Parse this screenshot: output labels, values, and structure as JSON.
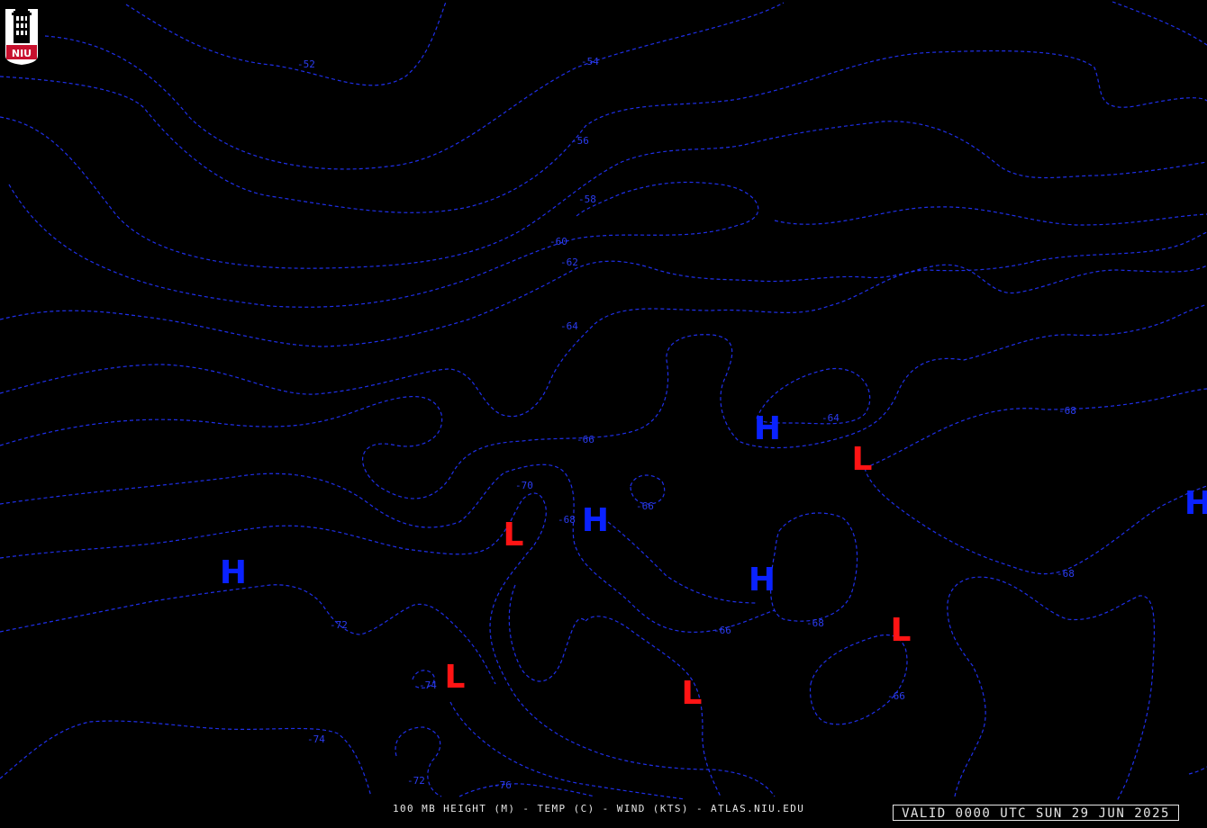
{
  "logo": {
    "text": "NIU",
    "colors": {
      "shield": "#ffffff",
      "banner": "#c8102e",
      "tower": "#000000"
    }
  },
  "footer": {
    "title": "100 MB HEIGHT (M) - TEMP (C) - WIND (KTS) - ATLAS.NIU.EDU",
    "valid_time": "VALID 0000 UTC SUN 29 JUN 2025"
  },
  "colors": {
    "background": "#000000",
    "isotherm": "#1f2fe8",
    "high": "#0a22ff",
    "low": "#ff1414",
    "text": "#e6e6e6"
  },
  "isotherm_labels": [
    "-52",
    "-54",
    "-56",
    "-58",
    "-60",
    "-62",
    "-64",
    "-66",
    "-70",
    "-68",
    "-66",
    "-72",
    "-74",
    "-64",
    "-68",
    "-66",
    "-68",
    "-66",
    "-68",
    "-72",
    "-76",
    "-74"
  ],
  "pressure_centers": [
    {
      "type": "H"
    },
    {
      "type": "H"
    },
    {
      "type": "H"
    },
    {
      "type": "H"
    },
    {
      "type": "H"
    },
    {
      "type": "L"
    },
    {
      "type": "L"
    },
    {
      "type": "L"
    },
    {
      "type": "L"
    },
    {
      "type": "L"
    }
  ]
}
